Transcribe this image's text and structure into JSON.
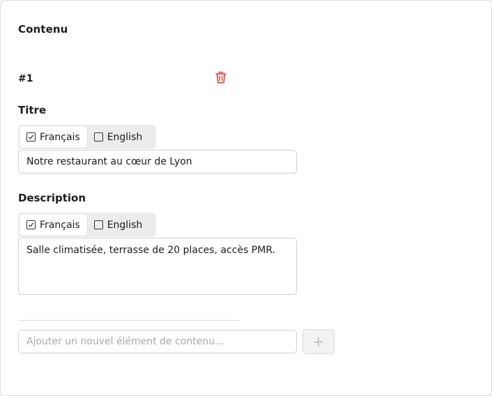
{
  "section": {
    "title": "Contenu"
  },
  "item": {
    "index": "#1",
    "delete_icon": "trash-icon",
    "title_label": "Titre",
    "description_label": "Description",
    "languages": [
      {
        "label": "Français",
        "checked": true,
        "active": true
      },
      {
        "label": "English",
        "checked": false,
        "active": false
      }
    ],
    "title_value": "Notre restaurant au cœur de Lyon",
    "description_value": "Salle climatisée, terrasse de 20 places, accès PMR."
  },
  "new_item": {
    "placeholder": "Ajouter un nouvel élément de contenu...",
    "add_label": "+"
  },
  "colors": {
    "danger": "#e53935",
    "border": "#cfcfcf",
    "tab_bg": "#ececec"
  }
}
